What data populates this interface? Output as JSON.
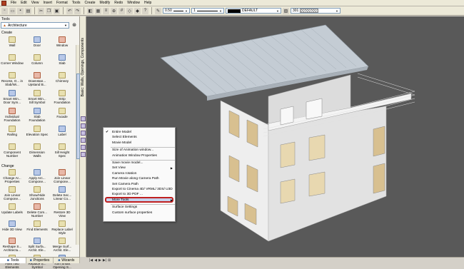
{
  "menubar": {
    "items": [
      "File",
      "Edit",
      "View",
      "Insert",
      "Format",
      "Tools",
      "Create",
      "Modify",
      "Redo",
      "Window",
      "Help"
    ]
  },
  "toolbar": {
    "line_weight": "0.50",
    "pen_color": "1",
    "line_style": "DEFAULT",
    "layer": "301"
  },
  "left_panel": {
    "title": "Tools",
    "category": "Architecture",
    "create_header": "Create",
    "create_tools": [
      "Wall",
      "Door",
      "Window",
      "Corner Window",
      "Column",
      "Slab",
      "Recess, O... in Slab/Wi...",
      "Downstan... Upstand B...",
      "Chimney",
      "Smart Win... Door Sym...",
      "Smart Win... Sill Symbol",
      "Strip Foundation",
      "Individual Foundation",
      "Slab Foundation",
      "Facade",
      "Railing",
      "Elevation Spec",
      "Label",
      "Component Number",
      "Dimension Walls",
      "Sill Height Spec"
    ],
    "change_header": "Change",
    "change_tools": [
      "Change Ar... Properties",
      "Apply Arc... Compone...",
      "Join Linear Compone...",
      "Join Linear Compone...",
      "Show/Hide Junctions",
      "Delete Sec... Linear Co...",
      "Update Labels",
      "Delete Com... Number",
      "Restore 3D View",
      "Hide 3D View",
      "Find Elements",
      "Replace Label Style",
      "Reshape S... Architectu...",
      "Split Surfa... Archit. Ele...",
      "Merge Surf... Archit. Ele...",
      "Fillet Two Elements",
      "Replace S... Symbol",
      "Turn Smart Opening S..."
    ],
    "bottom_tabs": [
      "Tools",
      "Properties",
      "Wizards"
    ]
  },
  "vertical_tab": "Basic: Walls, Openings, Components",
  "context_menu": {
    "items": [
      {
        "label": "Entire Model",
        "checked": true
      },
      {
        "label": "Select Elements"
      },
      {
        "label": "Movie Model"
      },
      {
        "sep": true
      },
      {
        "label": "Size of Animation window..."
      },
      {
        "label": "Animation Window Properties"
      },
      {
        "sep": true
      },
      {
        "label": "Save movie model..."
      },
      {
        "label": "Set View",
        "submenu": true
      },
      {
        "label": "Camera rotation"
      },
      {
        "label": "Run Movie along Camera Path"
      },
      {
        "label": "Set Camera Path"
      },
      {
        "label": "Export to Cinema 4D/ VRML/ 3DS/ U3D"
      },
      {
        "label": "Export to 3D PDF ...",
        "highlighted": true
      },
      {
        "label": "More Tools",
        "submenu": true
      },
      {
        "sep": true
      },
      {
        "label": "Surface Settings"
      },
      {
        "label": "Custom surface properties"
      }
    ]
  },
  "colors": {
    "viewport_bg": "#595959",
    "highlight_border": "#c02020"
  }
}
